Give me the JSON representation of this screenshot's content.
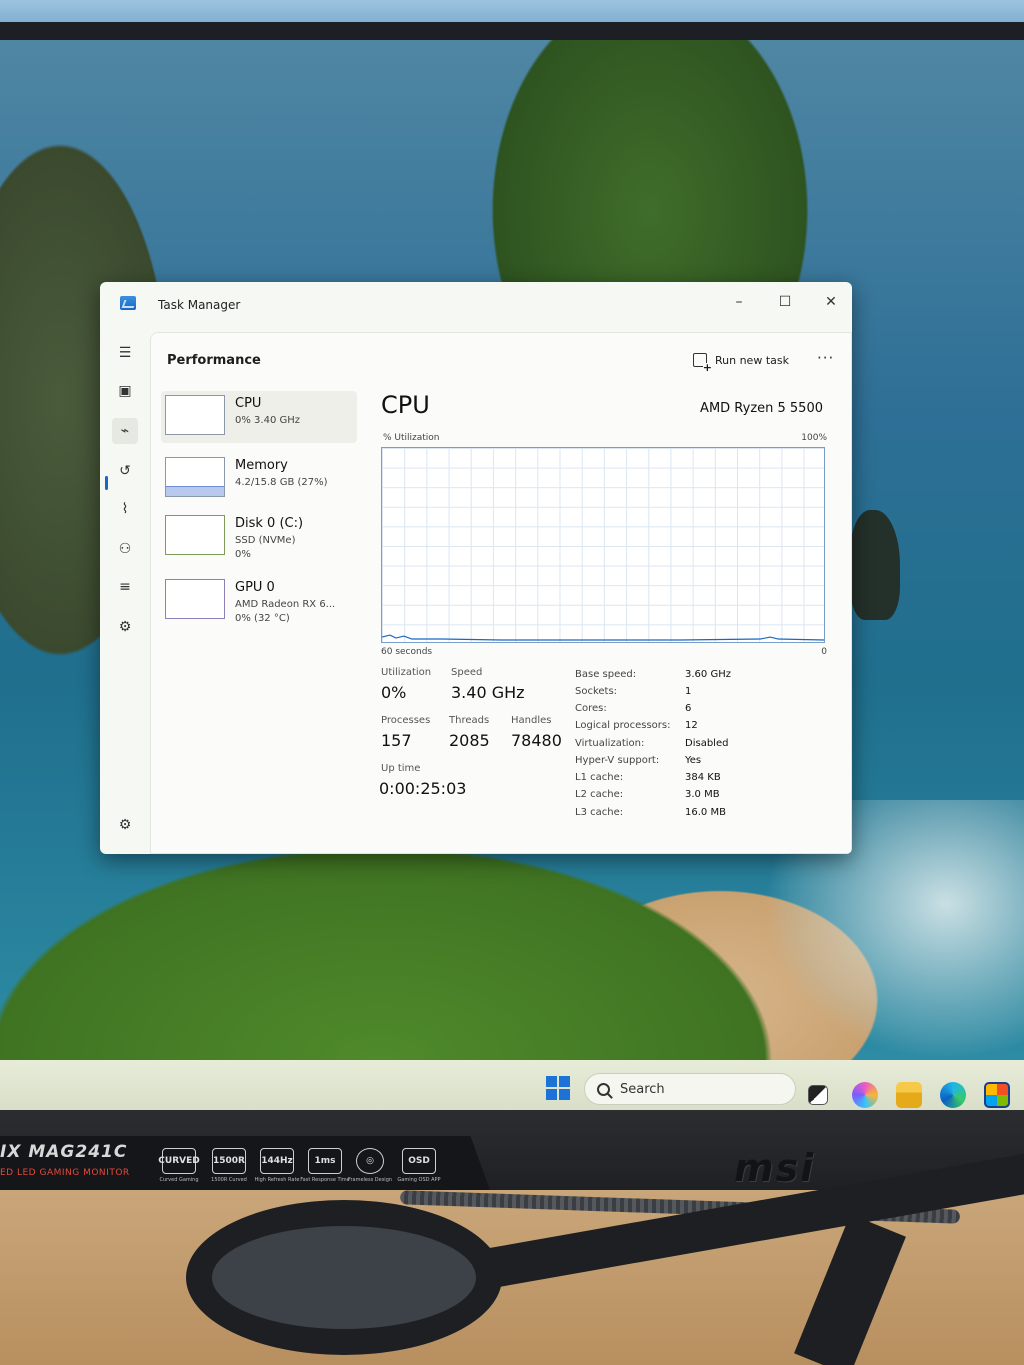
{
  "window": {
    "title": "Task Manager"
  },
  "header": {
    "page_title": "Performance",
    "run_new_task": "Run new task",
    "more": "···"
  },
  "resources": [
    {
      "name": "CPU",
      "sub1": "0% 3.40 GHz",
      "sub2": ""
    },
    {
      "name": "Memory",
      "sub1": "4.2/15.8 GB (27%)",
      "sub2": ""
    },
    {
      "name": "Disk 0 (C:)",
      "sub1": "SSD (NVMe)",
      "sub2": "0%"
    },
    {
      "name": "GPU 0",
      "sub1": "AMD Radeon RX 6...",
      "sub2": "0% (32 °C)"
    }
  ],
  "cpu": {
    "title": "CPU",
    "model": "AMD Ryzen 5 5500",
    "graph": {
      "ylabel": "% Utilization",
      "ymax_label": "100%",
      "xlabel": "60 seconds",
      "ymin_label": "0"
    },
    "stats": {
      "utilization_label": "Utilization",
      "utilization": "0%",
      "speed_label": "Speed",
      "speed": "3.40 GHz",
      "processes_label": "Processes",
      "processes": "157",
      "threads_label": "Threads",
      "threads": "2085",
      "handles_label": "Handles",
      "handles": "78480",
      "uptime_label": "Up time",
      "uptime": "0:00:25:03"
    },
    "specs": [
      {
        "label": "Base speed:",
        "value": "3.60 GHz"
      },
      {
        "label": "Sockets:",
        "value": "1"
      },
      {
        "label": "Cores:",
        "value": "6"
      },
      {
        "label": "Logical processors:",
        "value": "12"
      },
      {
        "label": "Virtualization:",
        "value": "Disabled"
      },
      {
        "label": "Hyper-V support:",
        "value": "Yes"
      },
      {
        "label": "L1 cache:",
        "value": "384 KB"
      },
      {
        "label": "L2 cache:",
        "value": "3.0 MB"
      },
      {
        "label": "L3 cache:",
        "value": "16.0 MB"
      }
    ]
  },
  "taskbar": {
    "search_placeholder": "Search"
  },
  "monitor": {
    "model": "IX MAG241C",
    "tagline": "ED LED GAMING MONITOR",
    "brand": "msi",
    "features": [
      {
        "badge": "CURVED",
        "label": "Curved Gaming"
      },
      {
        "badge": "1500R",
        "label": "1500R Curved"
      },
      {
        "badge": "144Hz",
        "label": "High Refresh Rate"
      },
      {
        "badge": "1ms",
        "label": "Fast Response Time"
      },
      {
        "badge": "◎",
        "label": "Frameless Design"
      },
      {
        "badge": "OSD",
        "label": "Gaming OSD APP"
      }
    ]
  },
  "colors": {
    "accent": "#1a66c2",
    "graph_border": "#7a9cc9",
    "window_bg": "#f6f8f3"
  },
  "icons": [
    "hamburger-icon",
    "processes-icon",
    "performance-icon",
    "app-history-icon",
    "startup-icon",
    "users-icon",
    "details-icon",
    "services-icon",
    "settings-icon"
  ]
}
